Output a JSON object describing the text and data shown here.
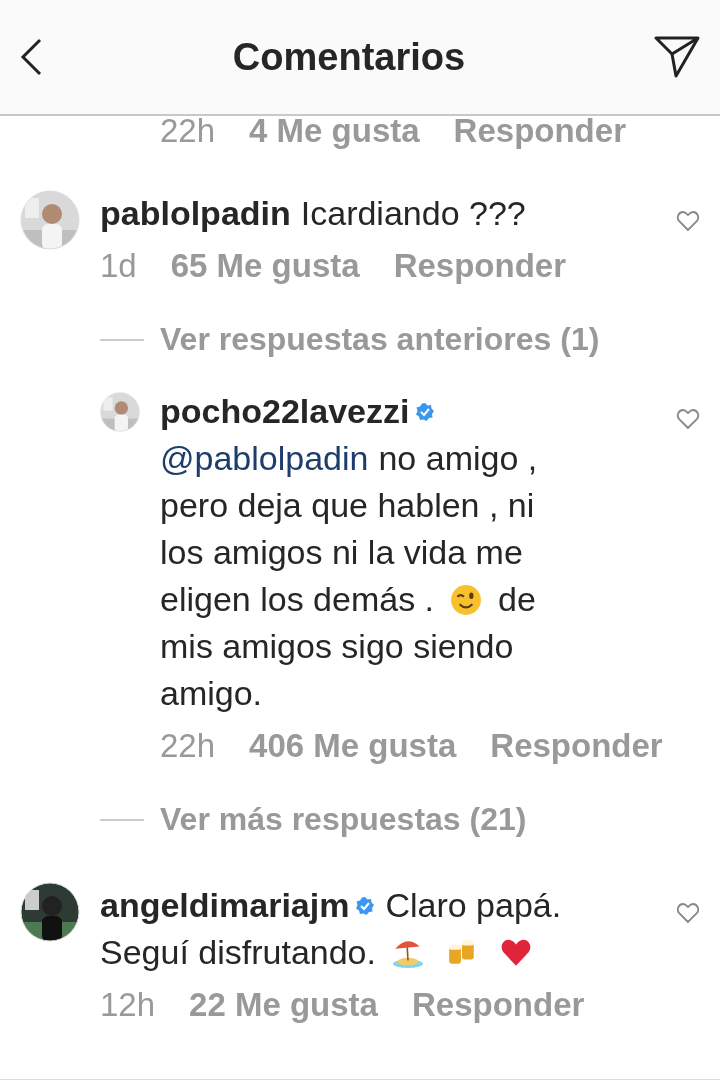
{
  "header": {
    "title": "Comentarios"
  },
  "comments": [
    {
      "kind": "meta_only",
      "time": "22h",
      "likes": "4 Me gusta",
      "reply": "Responder"
    },
    {
      "kind": "comment",
      "username": "pablolpadin",
      "verified": false,
      "lines": [
        [
          {
            "kind": "text",
            "text": "Icardiando ???"
          }
        ]
      ],
      "time": "1d",
      "likes": "65 Me gusta",
      "reply": "Responder",
      "liked": false
    },
    {
      "kind": "more",
      "text": "Ver respuestas anteriores (1)"
    },
    {
      "kind": "reply",
      "username": "pocho22lavezzi",
      "verified": true,
      "lines": [
        [
          {
            "kind": "mention",
            "text": "@pablolpadin"
          },
          {
            "kind": "text",
            "text": "no amigo ,"
          }
        ],
        [
          {
            "kind": "text",
            "text": "pero deja que hablen , ni"
          }
        ],
        [
          {
            "kind": "text",
            "text": "los amigos ni la vida me"
          }
        ],
        [
          {
            "kind": "text",
            "text": "eligen los demás ."
          },
          {
            "kind": "wink"
          },
          {
            "kind": "text",
            "text": "de"
          }
        ],
        [
          {
            "kind": "text",
            "text": "mis amigos sigo siendo"
          }
        ],
        [
          {
            "kind": "text",
            "text": "amigo."
          }
        ]
      ],
      "time": "22h",
      "likes": "406 Me gusta",
      "reply": "Responder",
      "liked": false
    },
    {
      "kind": "more",
      "text": "Ver más respuestas (21)"
    },
    {
      "kind": "comment",
      "username": "angeldimariajm",
      "verified": true,
      "lines": [
        [
          {
            "kind": "text",
            "text": "Claro papá."
          }
        ],
        [
          {
            "kind": "text",
            "text": "Seguí disfrutando."
          },
          {
            "kind": "island"
          },
          {
            "kind": "beers"
          },
          {
            "kind": "heart"
          }
        ]
      ],
      "time": "12h",
      "likes": "22 Me gusta",
      "reply": "Responder",
      "liked": false
    }
  ]
}
